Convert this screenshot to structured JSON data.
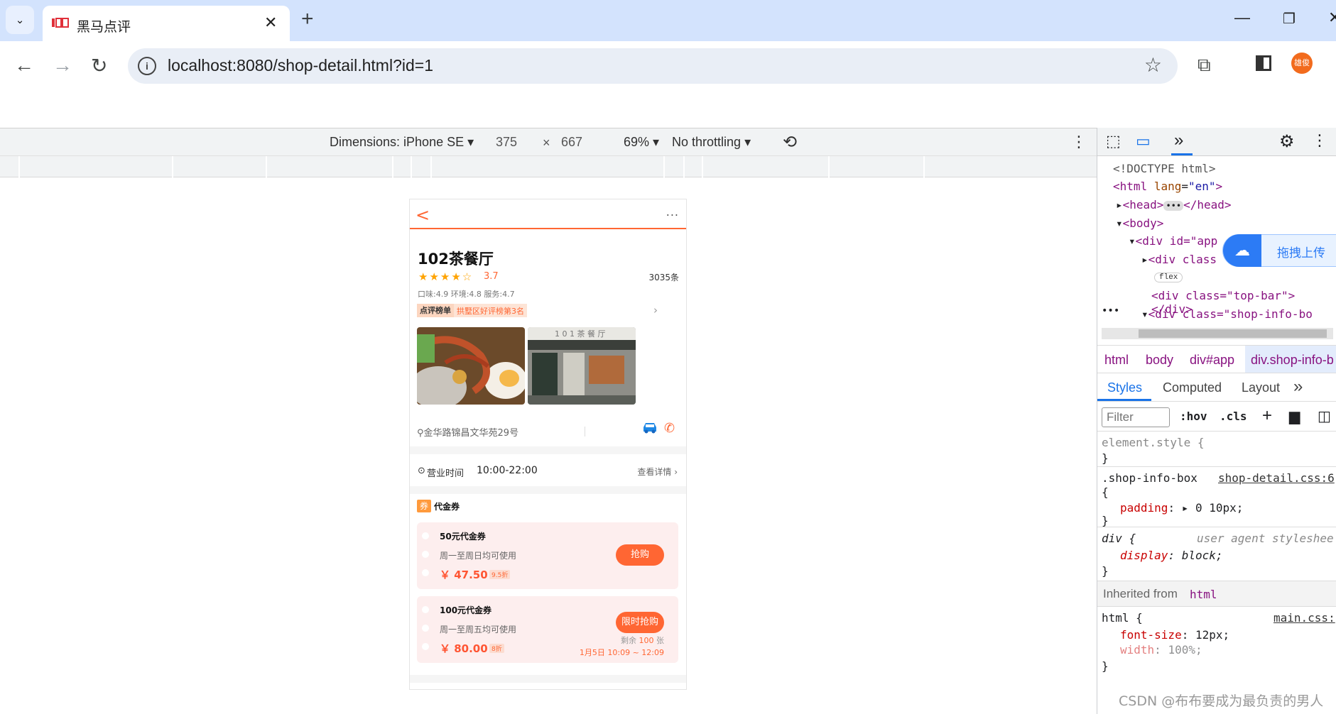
{
  "browser": {
    "tab_title": "黑马点评",
    "url": "localhost:8080/shop-detail.html?id=1",
    "profile_name": "雄俊"
  },
  "device_toolbar": {
    "dimensions_label": "Dimensions: iPhone SE",
    "width": "375",
    "times": "×",
    "height": "667",
    "zoom": "69%",
    "throttling": "No throttling"
  },
  "shop": {
    "back_glyph": "<",
    "more_glyph": "...",
    "name": "102茶餐厅",
    "rating_stars": 3.7,
    "stars_display": "★★★★☆",
    "score": "3.7",
    "comments": "3035条",
    "sub_scores": "口味:4.9 环境:4.8 服务:4.7",
    "rank_label": "点评榜单",
    "rank_text": "拱墅区好评榜第3名",
    "address": "金华路锦昌文华苑29号",
    "hours_label": "营业时间",
    "hours_value": "10:00-22:00",
    "hours_detail": "查看详情",
    "voucher_icon": "券",
    "voucher_title": "代金券",
    "vouchers": [
      {
        "name": "50元代金券",
        "rule": "周一至周日均可使用",
        "price": "￥ 47.50",
        "discount": "9.5折",
        "button": "抢购"
      },
      {
        "name": "100元代金券",
        "rule": "周一至周五均可使用",
        "price": "￥ 80.00",
        "discount": "8折",
        "button": "限时抢购",
        "remain_prefix": "剩余",
        "remain_count": "100",
        "remain_suffix": "张",
        "time": "1月5日 10:09 ~ 12:09"
      }
    ]
  },
  "devtools": {
    "elements": {
      "doctype": "<!DOCTYPE html>",
      "html_open": "<html",
      "lang_attr": "lang",
      "lang_val": "\"en\"",
      "head": "<head>",
      "head_close": "</head>",
      "body": "<body>",
      "div_app": "<div id=\"app",
      "div_class": "<div class",
      "flex_badge": "flex",
      "top_bar_line": "<div class=\"top-bar\"></div>",
      "shop_info_line": "<div class=\"shop-info-bo"
    },
    "upload_text": "拖拽上传",
    "breadcrumbs": [
      "html",
      "body",
      "div#app",
      "div.shop-info-b"
    ],
    "styles_tabs": [
      "Styles",
      "Computed",
      "Layout"
    ],
    "filter_placeholder": "Filter",
    "hov": ":hov",
    "cls": ".cls",
    "rules": {
      "element_style": "element.style {",
      "close": "}",
      "shop_info_selector": ".shop-info-box",
      "shop_info_source": "shop-detail.css:6",
      "open": "{",
      "padding_prop": "padding",
      "padding_val": "0 10px;",
      "div_selector": "div {",
      "ua_label": "user agent styleshee",
      "display_prop": "display",
      "display_val": "block;",
      "inherited_label": "Inherited from",
      "inherited_tag": "html",
      "html_selector": "html {",
      "main_source": "main.css:",
      "font_size_prop": "font-size",
      "font_size_val": "12px;",
      "width_prop": "width",
      "width_val": "100%;"
    }
  },
  "watermark": "CSDN @布布要成为最负责的男人"
}
